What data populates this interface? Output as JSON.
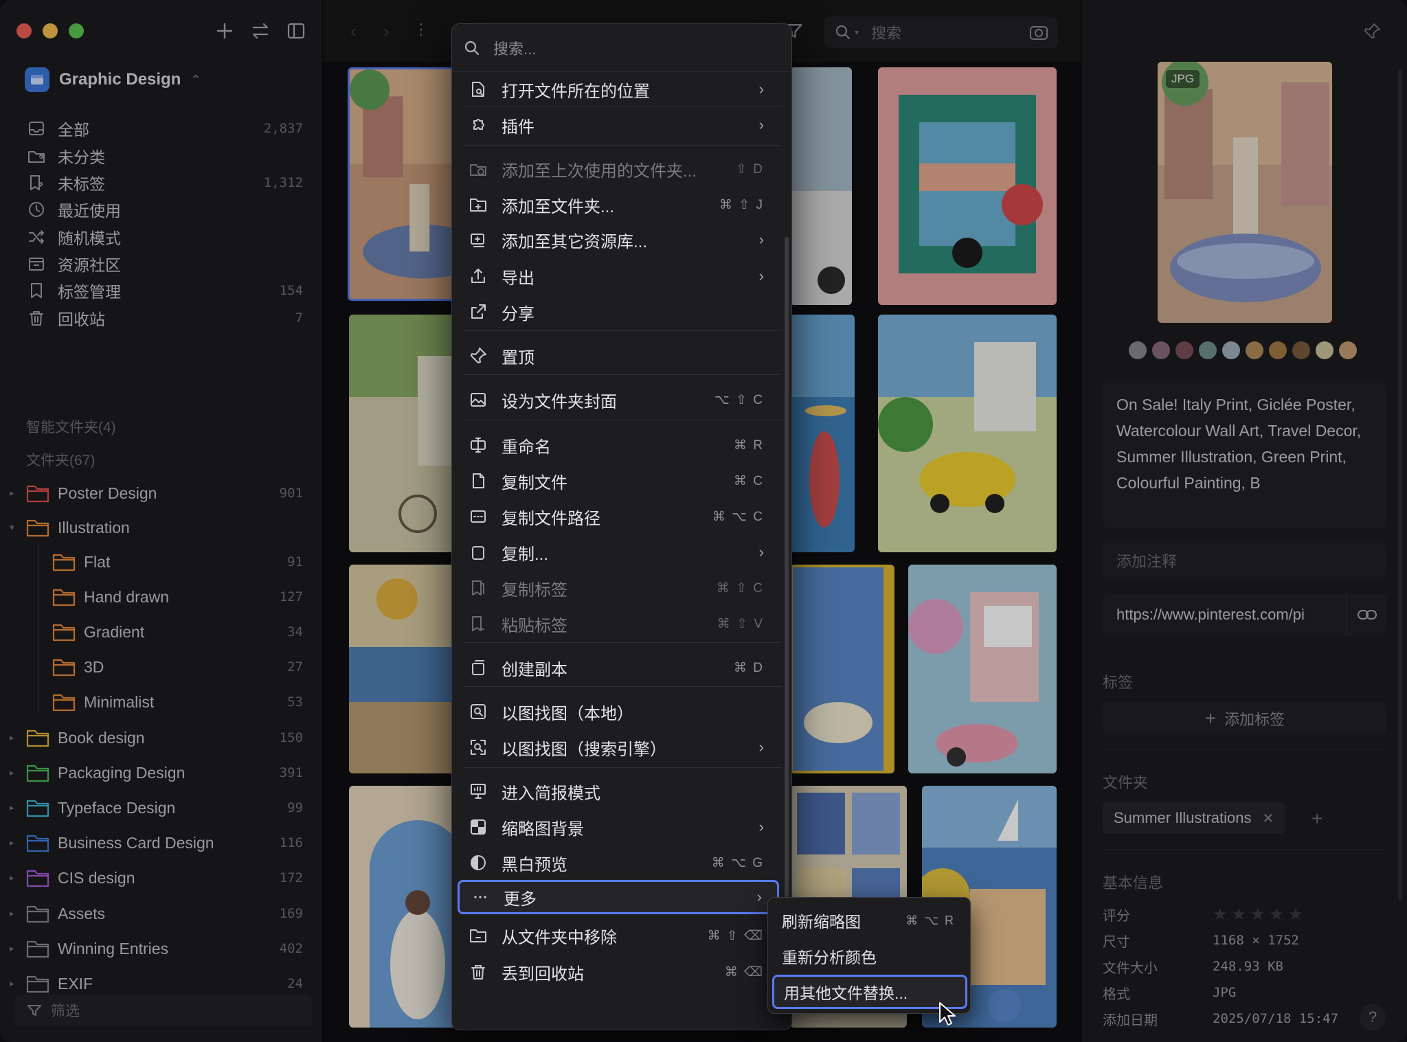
{
  "sidebar": {
    "library_name": "Graphic Design",
    "nav": [
      {
        "label": "全部",
        "count": "2,837",
        "icon": "inbox-icon"
      },
      {
        "label": "未分类",
        "count": "",
        "icon": "folder-question-icon"
      },
      {
        "label": "未标签",
        "count": "1,312",
        "icon": "tag-question-icon"
      },
      {
        "label": "最近使用",
        "count": "",
        "icon": "clock-icon"
      },
      {
        "label": "随机模式",
        "count": "",
        "icon": "shuffle-icon"
      },
      {
        "label": "资源社区",
        "count": "",
        "icon": "community-icon"
      },
      {
        "label": "标签管理",
        "count": "154",
        "icon": "bookmark-icon"
      },
      {
        "label": "回收站",
        "count": "7",
        "icon": "trash-icon"
      }
    ],
    "smart_folders_label": "智能文件夹(4)",
    "folders_label": "文件夹(67)",
    "folders": [
      {
        "label": "Poster Design",
        "count": "901",
        "color": "#e0504a"
      },
      {
        "label": "Illustration",
        "count": "",
        "color": "#e88a3a"
      },
      {
        "label": "Flat",
        "count": "91",
        "color": "#e88a3a"
      },
      {
        "label": "Hand drawn",
        "count": "127",
        "color": "#e88a3a"
      },
      {
        "label": "Gradient",
        "count": "34",
        "color": "#e88a3a"
      },
      {
        "label": "3D",
        "count": "27",
        "color": "#e88a3a"
      },
      {
        "label": "Minimalist",
        "count": "53",
        "color": "#e88a3a"
      },
      {
        "label": "Book design",
        "count": "150",
        "color": "#e5b43a"
      },
      {
        "label": "Packaging Design",
        "count": "391",
        "color": "#4bbd5a"
      },
      {
        "label": "Typeface Design",
        "count": "99",
        "color": "#3bb8d8"
      },
      {
        "label": "Business Card Design",
        "count": "116",
        "color": "#3b7fe0"
      },
      {
        "label": "CIS design",
        "count": "172",
        "color": "#a85be0"
      },
      {
        "label": "Assets",
        "count": "169",
        "color": "#8a8a90"
      },
      {
        "label": "Winning Entries",
        "count": "402",
        "color": "#8a8a90"
      },
      {
        "label": "EXIF",
        "count": "24",
        "color": "#8a8a90"
      }
    ],
    "filter_label": "筛选"
  },
  "toolbar": {
    "search_placeholder": "搜索"
  },
  "context_menu": {
    "search_placeholder": "搜索...",
    "items": [
      {
        "label": "打开文件所在的位置",
        "shortcut": "",
        "submenu": true,
        "disabled": false,
        "icon": "open-location-icon"
      },
      {
        "label": "插件",
        "shortcut": "",
        "submenu": true,
        "disabled": false,
        "icon": "plugin-icon"
      },
      {
        "label": "添加至上次使用的文件夹...",
        "shortcut": "⇧ D",
        "submenu": false,
        "disabled": true,
        "icon": "folder-history-icon"
      },
      {
        "label": "添加至文件夹...",
        "shortcut": "⌘ ⇧ J",
        "submenu": false,
        "disabled": false,
        "icon": "folder-add-icon"
      },
      {
        "label": "添加至其它资源库...",
        "shortcut": "",
        "submenu": true,
        "disabled": false,
        "icon": "library-add-icon"
      },
      {
        "label": "导出",
        "shortcut": "",
        "submenu": true,
        "disabled": false,
        "icon": "export-icon"
      },
      {
        "label": "分享",
        "shortcut": "",
        "submenu": false,
        "disabled": false,
        "icon": "share-icon"
      },
      {
        "label": "置顶",
        "shortcut": "",
        "submenu": false,
        "disabled": false,
        "icon": "pin-icon"
      },
      {
        "label": "设为文件夹封面",
        "shortcut": "⌥ ⇧ C",
        "submenu": false,
        "disabled": false,
        "icon": "cover-image-icon"
      },
      {
        "label": "重命名",
        "shortcut": "⌘ R",
        "submenu": false,
        "disabled": false,
        "icon": "rename-icon"
      },
      {
        "label": "复制文件",
        "shortcut": "⌘ C",
        "submenu": false,
        "disabled": false,
        "icon": "copy-file-icon"
      },
      {
        "label": "复制文件路径",
        "shortcut": "⌘ ⌥ C",
        "submenu": false,
        "disabled": false,
        "icon": "copy-path-icon"
      },
      {
        "label": "复制...",
        "shortcut": "",
        "submenu": true,
        "disabled": false,
        "icon": "copy-icon"
      },
      {
        "label": "复制标签",
        "shortcut": "⌘ ⇧ C",
        "submenu": false,
        "disabled": true,
        "icon": "copy-tag-icon"
      },
      {
        "label": "粘贴标签",
        "shortcut": "⌘ ⇧ V",
        "submenu": false,
        "disabled": true,
        "icon": "paste-tag-icon"
      },
      {
        "label": "创建副本",
        "shortcut": "⌘ D",
        "submenu": false,
        "disabled": false,
        "icon": "duplicate-icon"
      },
      {
        "label": "以图找图（本地）",
        "shortcut": "",
        "submenu": false,
        "disabled": false,
        "icon": "image-search-icon"
      },
      {
        "label": "以图找图（搜索引擎）",
        "shortcut": "",
        "submenu": true,
        "disabled": false,
        "icon": "image-search-web-icon"
      },
      {
        "label": "进入简报模式",
        "shortcut": "",
        "submenu": false,
        "disabled": false,
        "icon": "presentation-icon"
      },
      {
        "label": "缩略图背景",
        "shortcut": "",
        "submenu": true,
        "disabled": false,
        "icon": "checker-icon"
      },
      {
        "label": "黑白预览",
        "shortcut": "⌘ ⌥ G",
        "submenu": false,
        "disabled": false,
        "icon": "grayscale-icon"
      },
      {
        "label": "更多",
        "shortcut": "",
        "submenu": true,
        "disabled": false,
        "icon": "more-icon"
      },
      {
        "label": "从文件夹中移除",
        "shortcut": "⌘ ⇧ ⌫",
        "submenu": false,
        "disabled": false,
        "icon": "folder-remove-icon"
      },
      {
        "label": "丢到回收站",
        "shortcut": "⌘ ⌫",
        "submenu": false,
        "disabled": false,
        "icon": "trash-icon"
      }
    ]
  },
  "submenu": {
    "items": [
      {
        "label": "刷新缩略图",
        "shortcut": "⌘ ⌥ R"
      },
      {
        "label": "重新分析颜色",
        "shortcut": ""
      },
      {
        "label": "用其他文件替换...",
        "shortcut": ""
      }
    ]
  },
  "inspector": {
    "format_badge": "JPG",
    "palette": [
      "#8a8790",
      "#8a6a7a",
      "#7a4f5c",
      "#6f8f8a",
      "#9fb0bd",
      "#b08a5a",
      "#a07a44",
      "#7a5a3a",
      "#c9c09a",
      "#c29a70"
    ],
    "description": "On Sale! Italy Print, Giclée Poster, Watercolour Wall Art, Travel Decor, Summer Illustration, Green Print, Colourful Painting, B",
    "note_placeholder": "添加注释",
    "url": "https://www.pinterest.com/pi",
    "tags_label": "标签",
    "add_tag_label": "添加标签",
    "folder_label": "文件夹",
    "folder_chip": "Summer Illustrations",
    "basic_info_label": "基本信息",
    "info": {
      "rating_label": "评分",
      "rating": 0,
      "size_label": "尺寸",
      "size": "1168 × 1752",
      "filesize_label": "文件大小",
      "filesize": "248.93 KB",
      "format_label": "格式",
      "format": "JPG",
      "added_label": "添加日期",
      "added": "2025/07/18 15:47"
    }
  }
}
